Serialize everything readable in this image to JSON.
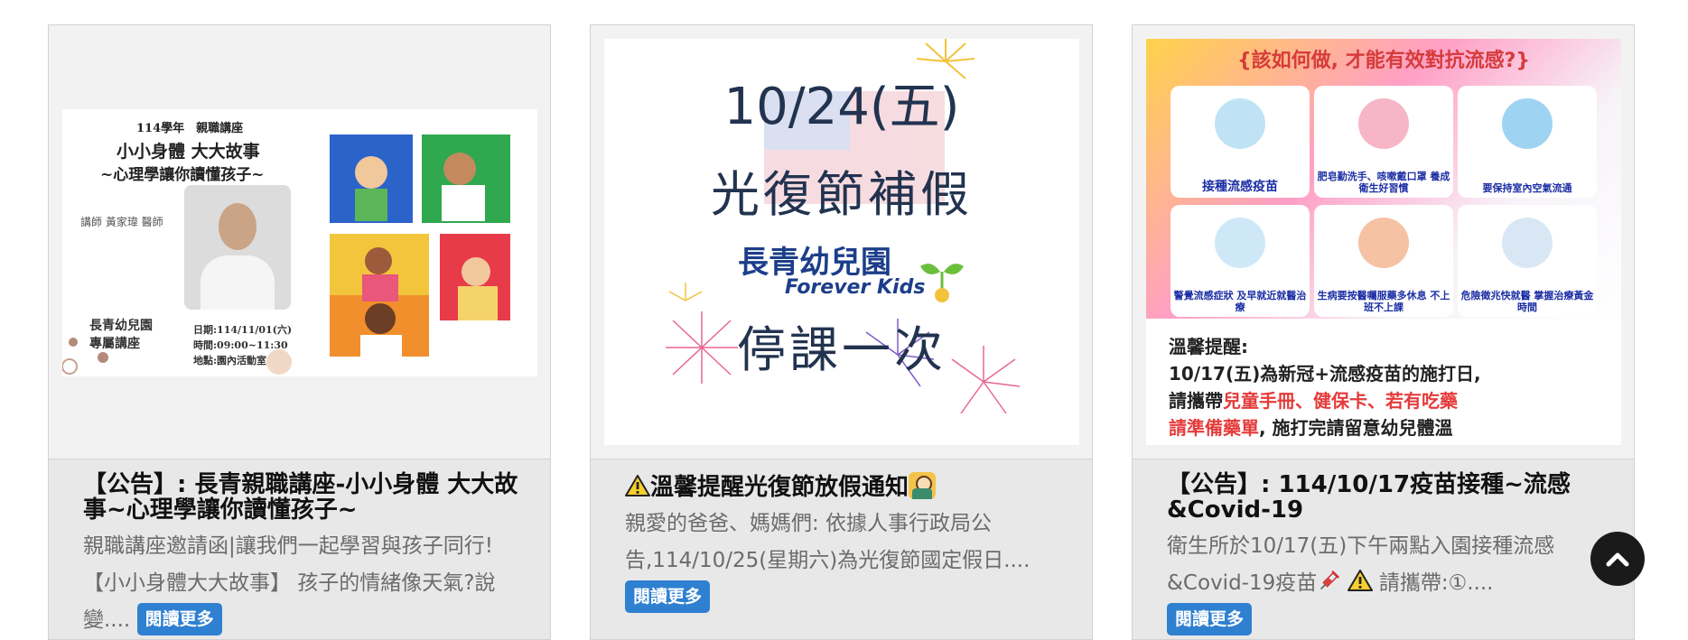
{
  "cards": [
    {
      "title": "【公告】: 長青親職講座-小小身體 大大故事~心理學讓你讀懂孩子~",
      "excerpt": "親職講座邀請函|讓我們一起學習與孩子同行!【小小身體大大故事】 孩子的情緒像天氣?說變....",
      "more": "閱讀更多",
      "thumb": {
        "line1": "114學年　親職講座",
        "line2": "小小身體 大大故事",
        "line3": "~心理學讓你讀懂孩子~",
        "speaker": "講師 黃家瑋 醫師",
        "school1": "長青幼兒園",
        "school2": "專屬講座",
        "date": "日期:114/11/01(六)",
        "time": "時間:09:00~11:30",
        "place": "地點:園內活動室"
      }
    },
    {
      "title": "溫馨提醒光復節放假通知",
      "excerpt": "親愛的爸爸、媽媽們: 依據人事行政局公告,114/10/25(星期六)為光復節國定假日....",
      "more": "閱讀更多",
      "thumb": {
        "date": "10/24(五)",
        "holiday": "光復節補假",
        "school": "長青幼兒園",
        "brand": "Forever Kids",
        "notice": "停課一次"
      }
    },
    {
      "title": "【公告】: 114/10/17疫苗接種~流感&Covid-19",
      "excerpt_a": "衛生所於10/17(五)下午兩點入園接種流感&Covid-19疫苗",
      "excerpt_b": "請攜帶:①....",
      "more": "閱讀更多",
      "thumb": {
        "question": "{該如何做, 才能有效對抗流感?}",
        "tiles": [
          "接種流感疫苗",
          "肥皂勤洗手、咳嗽戴口罩 養成衛生好習慣",
          "要保持室內空氣流通",
          "警覺流感症狀 及早就近就醫治療",
          "生病要按醫囑服藥多休息 不上班不上課",
          "危險徵兆快就醫 掌握治療黃金時間"
        ],
        "note_title": "溫馨提醒:",
        "note_1": "10/17(五)為新冠+流感疫苗的施打日,",
        "note_2a": "請攜帶",
        "note_2b": "兒童手冊、健保卡、若有吃藥",
        "note_3a": "請準備藥單",
        "note_3b": ", 施打完請留意幼兒體溫"
      }
    }
  ],
  "colors": {
    "accent": "#2f80d1",
    "card_bg": "#e8e8e8",
    "excerpt": "#6b6b6b"
  },
  "icons": [
    "warning-icon",
    "teacher-emoji-icon",
    "syringe-icon",
    "chevron-up-icon"
  ]
}
